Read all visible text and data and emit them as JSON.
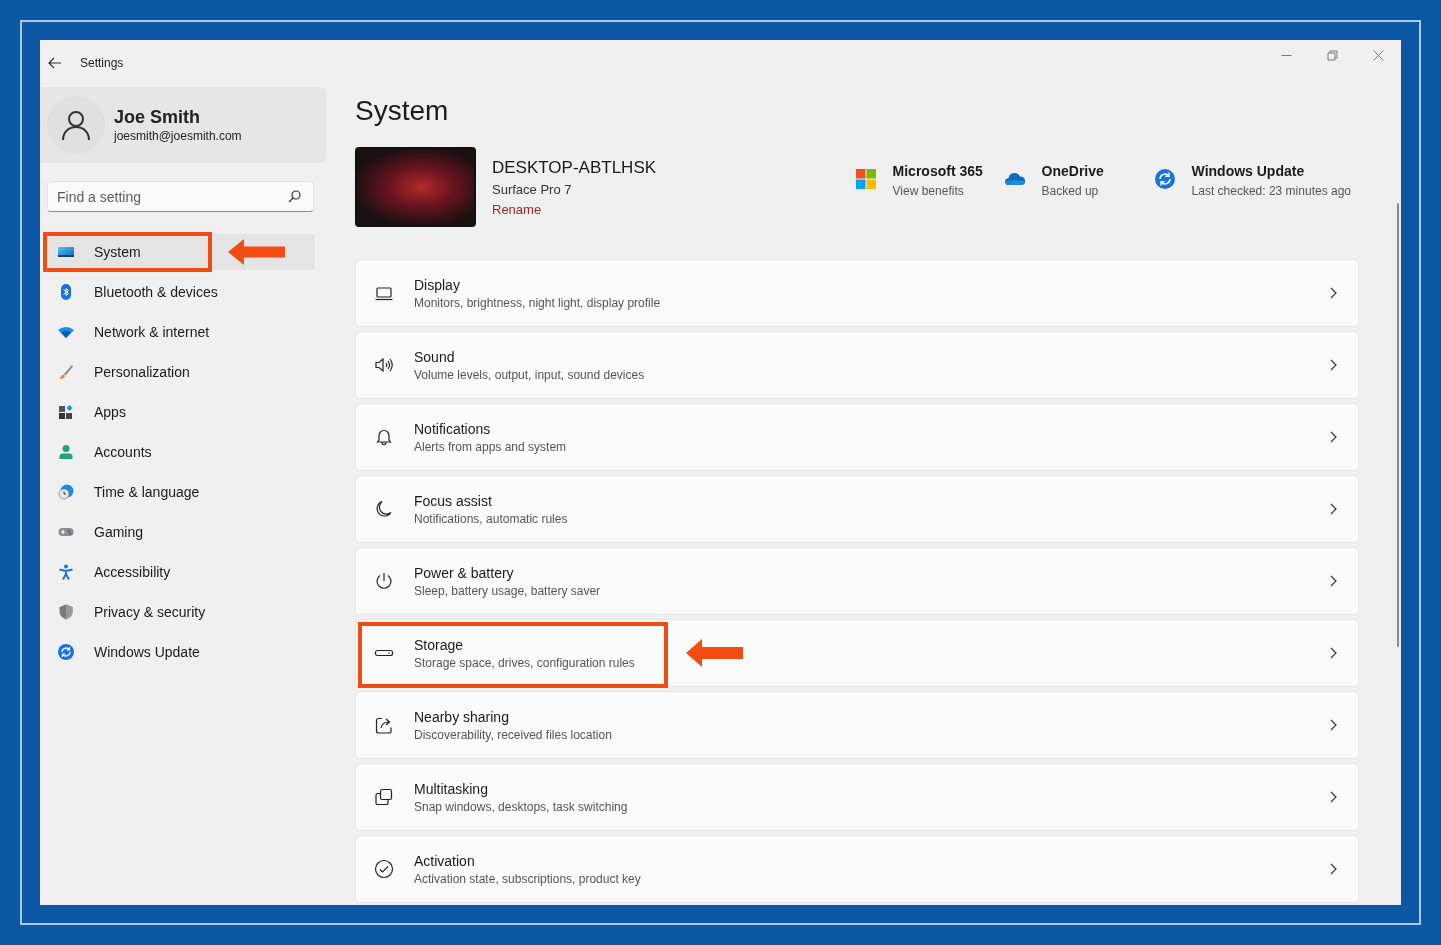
{
  "window": {
    "title": "Settings"
  },
  "profile": {
    "name": "Joe Smith",
    "email": "joesmith@joesmith.com"
  },
  "search": {
    "placeholder": "Find a setting"
  },
  "nav": [
    {
      "label": "System",
      "selected": true,
      "highlighted": true
    },
    {
      "label": "Bluetooth & devices",
      "selected": false,
      "highlighted": false
    },
    {
      "label": "Network & internet",
      "selected": false,
      "highlighted": false
    },
    {
      "label": "Personalization",
      "selected": false,
      "highlighted": false
    },
    {
      "label": "Apps",
      "selected": false,
      "highlighted": false
    },
    {
      "label": "Accounts",
      "selected": false,
      "highlighted": false
    },
    {
      "label": "Time & language",
      "selected": false,
      "highlighted": false
    },
    {
      "label": "Gaming",
      "selected": false,
      "highlighted": false
    },
    {
      "label": "Accessibility",
      "selected": false,
      "highlighted": false
    },
    {
      "label": "Privacy & security",
      "selected": false,
      "highlighted": false
    },
    {
      "label": "Windows Update",
      "selected": false,
      "highlighted": false
    }
  ],
  "page_title": "System",
  "device": {
    "name": "DESKTOP-ABTLHSK",
    "model": "Surface Pro 7",
    "rename_link": "Rename"
  },
  "services": [
    {
      "title": "Microsoft 365",
      "subtitle": "View benefits"
    },
    {
      "title": "OneDrive",
      "subtitle": "Backed up"
    },
    {
      "title": "Windows Update",
      "subtitle": "Last checked: 23 minutes ago"
    }
  ],
  "cards": [
    {
      "title": "Display",
      "description": "Monitors, brightness, night light, display profile",
      "highlighted": false
    },
    {
      "title": "Sound",
      "description": "Volume levels, output, input, sound devices",
      "highlighted": false
    },
    {
      "title": "Notifications",
      "description": "Alerts from apps and system",
      "highlighted": false
    },
    {
      "title": "Focus assist",
      "description": "Notifications, automatic rules",
      "highlighted": false
    },
    {
      "title": "Power & battery",
      "description": "Sleep, battery usage, battery saver",
      "highlighted": false
    },
    {
      "title": "Storage",
      "description": "Storage space, drives, configuration rules",
      "highlighted": true
    },
    {
      "title": "Nearby sharing",
      "description": "Discoverability, received files location",
      "highlighted": false
    },
    {
      "title": "Multitasking",
      "description": "Snap windows, desktops, task switching",
      "highlighted": false
    },
    {
      "title": "Activation",
      "description": "Activation state, subscriptions, product key",
      "highlighted": false
    }
  ]
}
